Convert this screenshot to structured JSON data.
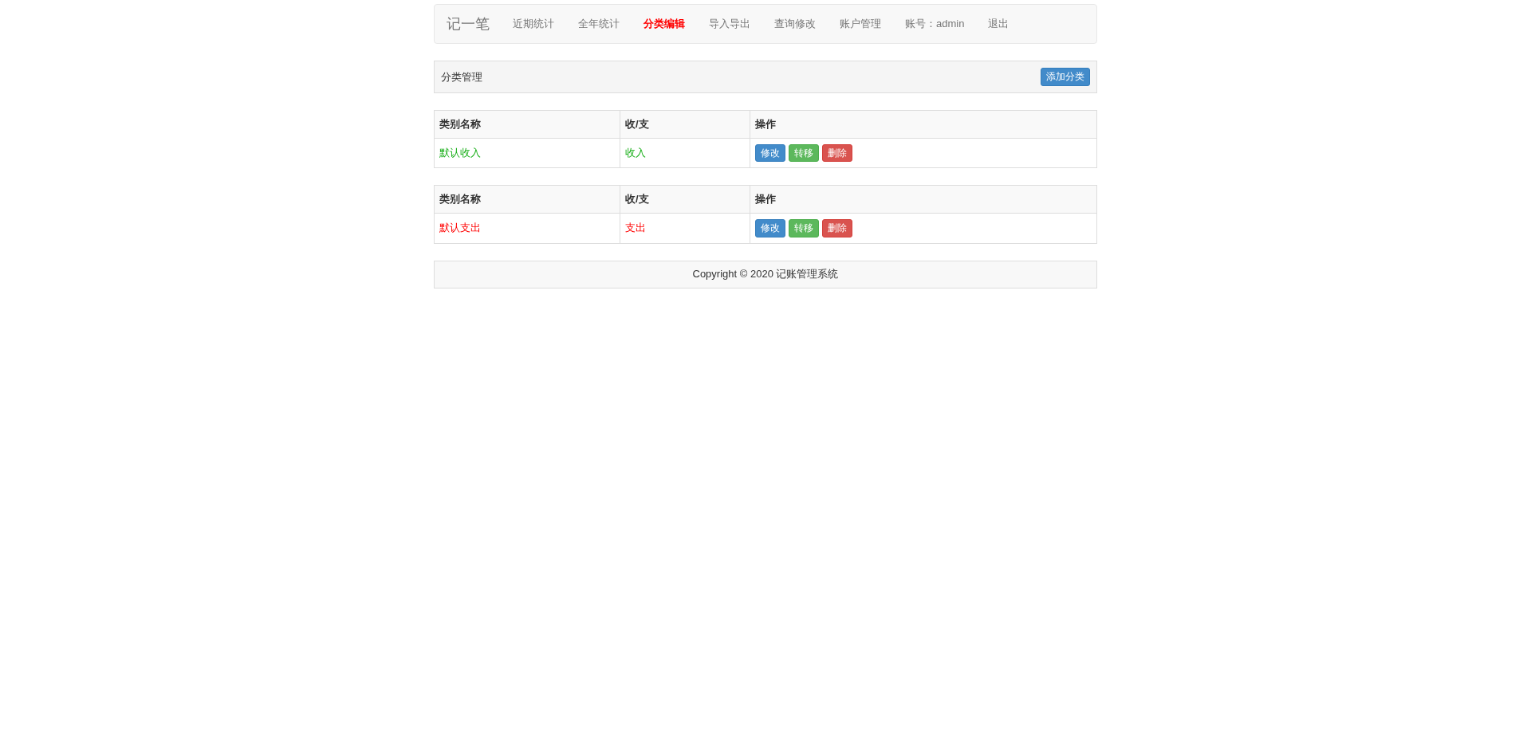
{
  "navbar": {
    "brand": "记一笔",
    "items": [
      {
        "label": "近期统计",
        "selected": false
      },
      {
        "label": "全年统计",
        "selected": false
      },
      {
        "label": "分类编辑",
        "selected": true
      },
      {
        "label": "导入导出",
        "selected": false
      },
      {
        "label": "查询修改",
        "selected": false
      },
      {
        "label": "账户管理",
        "selected": false
      },
      {
        "label": "账号：admin",
        "selected": false
      },
      {
        "label": "退出",
        "selected": false
      }
    ]
  },
  "panel": {
    "title": "分类管理",
    "button": "添加分类"
  },
  "tables": [
    {
      "columns": [
        "类别名称",
        "收/支",
        "操作"
      ],
      "rows": [
        {
          "kind": "income",
          "name": "默认收入",
          "type": "收入",
          "actions": [
            {
              "kind": "edit",
              "label": "修改"
            },
            {
              "kind": "move",
              "label": "转移"
            },
            {
              "kind": "delete",
              "label": "删除"
            }
          ]
        }
      ]
    },
    {
      "columns": [
        "类别名称",
        "收/支",
        "操作"
      ],
      "rows": [
        {
          "kind": "expense",
          "name": "默认支出",
          "type": "支出",
          "actions": [
            {
              "kind": "edit",
              "label": "修改"
            },
            {
              "kind": "move",
              "label": "转移"
            },
            {
              "kind": "delete",
              "label": "删除"
            }
          ]
        }
      ]
    }
  ],
  "footer": "Copyright © 2020 记账管理系统"
}
